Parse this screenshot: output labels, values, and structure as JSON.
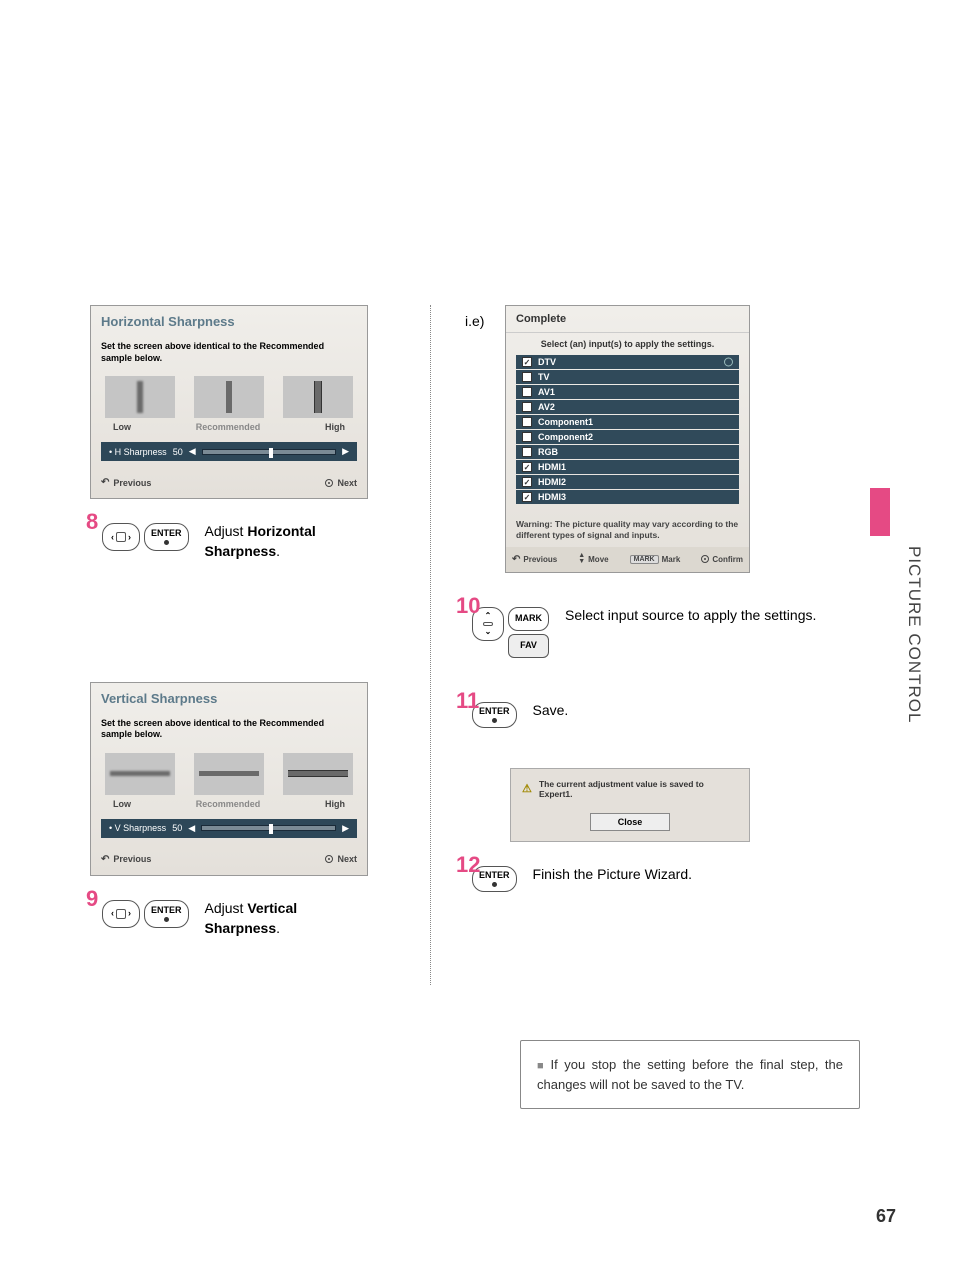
{
  "side_section": "PICTURE CONTROL",
  "page_number": "67",
  "horizontal": {
    "title": "Horizontal Sharpness",
    "instruction": "Set the screen above identical to the Recommended sample  below.",
    "labels": {
      "low": "Low",
      "mid": "Recommended",
      "high": "High"
    },
    "slider_label": "• H Sharpness",
    "slider_value": "50",
    "prev": "Previous",
    "next": "Next"
  },
  "vertical": {
    "title": "Vertical Sharpness",
    "instruction": "Set the screen above identical to the Recommended sample  below.",
    "labels": {
      "low": "Low",
      "mid": "Recommended",
      "high": "High"
    },
    "slider_label": "• V Sharpness",
    "slider_value": "50",
    "prev": "Previous",
    "next": "Next"
  },
  "step8": {
    "num": "8",
    "enter": "ENTER",
    "action": "Adjust ",
    "param": "Horizontal Sharpness",
    "suffix": "."
  },
  "step9": {
    "num": "9",
    "enter": "ENTER",
    "action": "Adjust ",
    "param": "Vertical Sharpness",
    "suffix": "."
  },
  "ie_label": "i.e)",
  "complete": {
    "title": "Complete",
    "subtitle": "Select (an) input(s) to apply the settings.",
    "inputs": [
      {
        "label": "DTV",
        "checked": true,
        "selected": true
      },
      {
        "label": "TV",
        "checked": false,
        "selected": false
      },
      {
        "label": "AV1",
        "checked": false,
        "selected": false
      },
      {
        "label": "AV2",
        "checked": false,
        "selected": false
      },
      {
        "label": "Component1",
        "checked": false,
        "selected": false
      },
      {
        "label": "Component2",
        "checked": false,
        "selected": false
      },
      {
        "label": "RGB",
        "checked": false,
        "selected": false
      },
      {
        "label": "HDMI1",
        "checked": true,
        "selected": false
      },
      {
        "label": "HDMI2",
        "checked": true,
        "selected": false
      },
      {
        "label": "HDMI3",
        "checked": true,
        "selected": false
      }
    ],
    "warning": "Warning: The picture quality  may vary according to the different types of signal and inputs.",
    "footer": {
      "prev": "Previous",
      "move": "Move",
      "mark_box": "MARK",
      "mark": "Mark",
      "confirm": "Confirm"
    }
  },
  "step10": {
    "num": "10",
    "mark": "MARK",
    "fav": "FAV",
    "text": "Select input source to apply the settings."
  },
  "step11": {
    "num": "11",
    "enter": "ENTER",
    "text": "Save."
  },
  "save_box": {
    "message": "The current adjustment value is saved to Expert1.",
    "close": "Close"
  },
  "step12": {
    "num": "12",
    "enter": "ENTER",
    "text": "Finish the Picture Wizard."
  },
  "note": "If you stop the setting before the final step, the changes will not be saved to the TV."
}
